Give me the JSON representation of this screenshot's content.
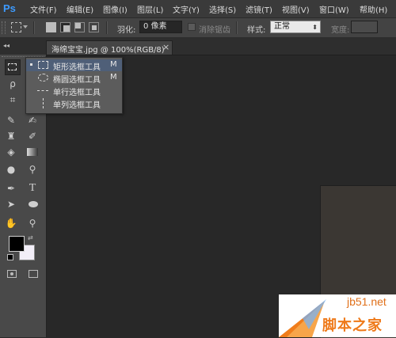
{
  "app": {
    "logo": "Ps"
  },
  "menu": [
    "文件(F)",
    "编辑(E)",
    "图像(I)",
    "图层(L)",
    "文字(Y)",
    "选择(S)",
    "滤镜(T)",
    "视图(V)",
    "窗口(W)",
    "帮助(H)"
  ],
  "options_bar": {
    "feather_label": "羽化:",
    "feather_value": "0 像素",
    "antialias_label": "消除锯齿",
    "style_label": "样式:",
    "style_value": "正常",
    "width_label": "宽度:"
  },
  "document_tab": {
    "title": "海绵宝宝.jpg @ 100%(RGB/8)",
    "close": "×"
  },
  "flyout": [
    {
      "label": "矩形选框工具",
      "shortcut": "M",
      "active": true
    },
    {
      "label": "椭圆选框工具",
      "shortcut": "M",
      "active": false
    },
    {
      "label": "单行选框工具",
      "shortcut": "",
      "active": false
    },
    {
      "label": "单列选框工具",
      "shortcut": "",
      "active": false
    }
  ],
  "watermark": {
    "site": "jb51.net",
    "name": "脚本之家"
  },
  "colors": {
    "accent": "#3d9bff",
    "foreground": "#000000",
    "background": "#f2eef8",
    "watermark_orange": "#f07d1b"
  }
}
